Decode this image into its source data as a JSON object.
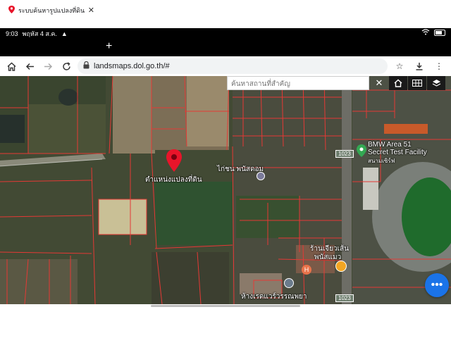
{
  "status_bar": {
    "time": "9:03",
    "date": "พฤหัส 4 ส.ค."
  },
  "browser": {
    "tab_title": "ระบบค้นหารูปแปลงที่ดิน (Lan",
    "url": "landsmaps.dol.go.th/#",
    "new_tab_label": "+"
  },
  "map": {
    "search_placeholder": "ค้นหาสถานที่สำคัญ",
    "marker_label": "ตำแหน่งแปลงที่ดิน",
    "labels": {
      "bmw_line1": "BMW Area 51",
      "bmw_line2": "Secret Test Facility",
      "stadium": "สนามเซิร์ฟ",
      "village": "ไก่ชน พนัสดอม",
      "shop1": "ร้านเจียวเส้น",
      "shop2": "พนัสแมว",
      "road1": "1023",
      "road2": "1023",
      "bottom_shop": "ห้างเรดแวร์วรรณพยา"
    },
    "parcel_color": "#e53935",
    "marker_color": "#e8142a"
  },
  "icons": {
    "home": "home-icon",
    "back": "arrow-left-icon",
    "forward": "arrow-right-icon",
    "reload": "reload-icon",
    "lock": "lock-icon",
    "star": "star-icon",
    "download": "download-icon",
    "menu": "more-vert-icon"
  }
}
